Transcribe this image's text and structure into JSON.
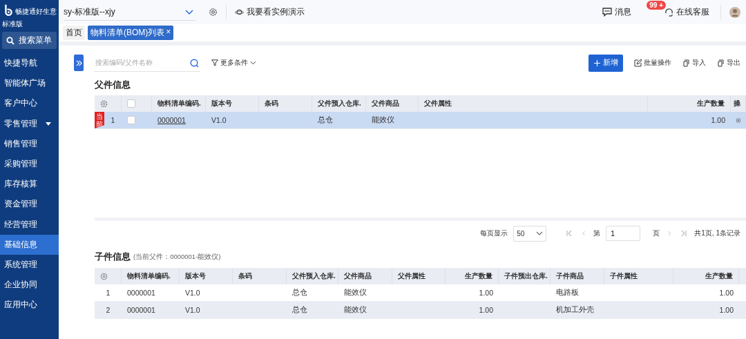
{
  "brand": {
    "slogan": "畅捷通好生意",
    "edition": "标准版"
  },
  "sidebar": {
    "search": "搜索菜单",
    "items": [
      {
        "label": "快捷导航",
        "selected": false,
        "has_submenu": false
      },
      {
        "label": "智能体广场",
        "selected": false,
        "has_submenu": false
      },
      {
        "label": "客户中心",
        "selected": false,
        "has_submenu": false
      },
      {
        "label": "零售管理",
        "selected": false,
        "has_submenu": true
      },
      {
        "label": "销售管理",
        "selected": false,
        "has_submenu": false
      },
      {
        "label": "采购管理",
        "selected": false,
        "has_submenu": false
      },
      {
        "label": "库存核算",
        "selected": false,
        "has_submenu": false
      },
      {
        "label": "资金管理",
        "selected": false,
        "has_submenu": false
      },
      {
        "label": "经营管理",
        "selected": false,
        "has_submenu": false
      },
      {
        "label": "基础信息",
        "selected": true,
        "has_submenu": false
      },
      {
        "label": "系统管理",
        "selected": false,
        "has_submenu": false
      },
      {
        "label": "企业协同",
        "selected": false,
        "has_submenu": false
      },
      {
        "label": "应用中心",
        "selected": false,
        "has_submenu": false
      }
    ]
  },
  "topbar": {
    "account": "sy-标准版--xjy",
    "demo": "我要看实例演示",
    "messages": "消息",
    "message_badge": "99 +",
    "support": "在线客服"
  },
  "tabs": [
    {
      "label": "首页",
      "selected": false,
      "closable": false
    },
    {
      "label": "物料清单(BOM)列表",
      "selected": true,
      "closable": true,
      "close": "×"
    }
  ],
  "toolbar": {
    "search_placeholder": "搜索编码/父件名称",
    "filter": "更多条件",
    "new": "新增",
    "batch": "批量操作",
    "import": "导入",
    "export": "导出"
  },
  "parent": {
    "title": "父件信息",
    "select_all_checked": false,
    "columns": [
      "物料清单编码.",
      "版本号",
      "条码",
      "父件预入仓库.",
      "父件商品",
      "父件属性",
      "生产数量",
      "操"
    ],
    "rows": [
      {
        "ribbon": "当前",
        "index": "1",
        "checked": false,
        "selected": true,
        "cells": [
          "0000001",
          "V1.0",
          "",
          "总仓",
          "能效仪",
          "",
          "1.00"
        ]
      }
    ]
  },
  "pagination": {
    "per_page_label": "每页显示",
    "per_page": "50",
    "page_prefix": "第",
    "page": "1",
    "page_suffix": "页",
    "summary": "共1页, 1条记录"
  },
  "child": {
    "title": "子件信息",
    "note": "(当前父件：0000001-能效仪)",
    "columns": [
      "物料清单编码.",
      "版本号",
      "条码",
      "父件预入仓库.",
      "父件商品",
      "父件属性",
      "生产数量",
      "子件预出仓库.",
      "子件商品",
      "子件属性",
      "生产数量"
    ],
    "rows": [
      {
        "index": "1",
        "selected": false,
        "cells": [
          "0000001",
          "V1.0",
          "",
          "总仓",
          "能效仪",
          "",
          "1.00",
          "",
          "电路板",
          "",
          "1.00"
        ]
      },
      {
        "index": "2",
        "selected": true,
        "cells": [
          "0000001",
          "V1.0",
          "",
          "总仓",
          "能效仪",
          "",
          "1.00",
          "",
          "机加工外壳",
          "",
          "1.00"
        ]
      }
    ]
  }
}
